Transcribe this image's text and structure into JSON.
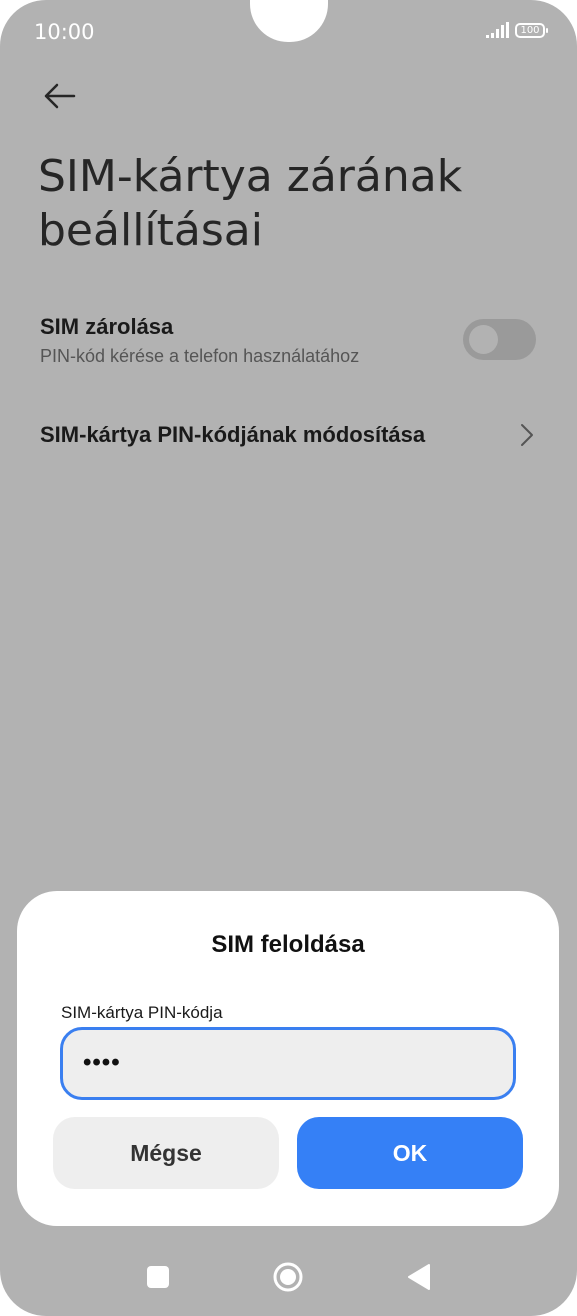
{
  "status_bar": {
    "time": "10:00",
    "battery": "100",
    "icons": [
      "signal-icon",
      "battery-icon"
    ]
  },
  "header": {
    "back_icon": "back-arrow-icon",
    "title": "SIM-kártya zárának beállításai"
  },
  "settings": {
    "sim_lock": {
      "title": "SIM zárolása",
      "subtitle": "PIN-kód kérése a telefon használatához",
      "toggle_on": false
    },
    "change_pin": {
      "title": "SIM-kártya PIN-kódjának módosítása",
      "chevron_icon": "chevron-right-icon"
    }
  },
  "dialog": {
    "title": "SIM feloldása",
    "field_label": "SIM-kártya PIN-kódja",
    "pin_value": "••••",
    "cancel_label": "Mégse",
    "ok_label": "OK"
  },
  "nav_bar": {
    "icons": [
      "recents-square-icon",
      "home-circle-icon",
      "back-triangle-icon"
    ]
  },
  "colors": {
    "scrim": "#b2b2b2",
    "accent": "#3580f6",
    "field_border": "#3a7ff0",
    "field_bg": "#eeeeee"
  }
}
